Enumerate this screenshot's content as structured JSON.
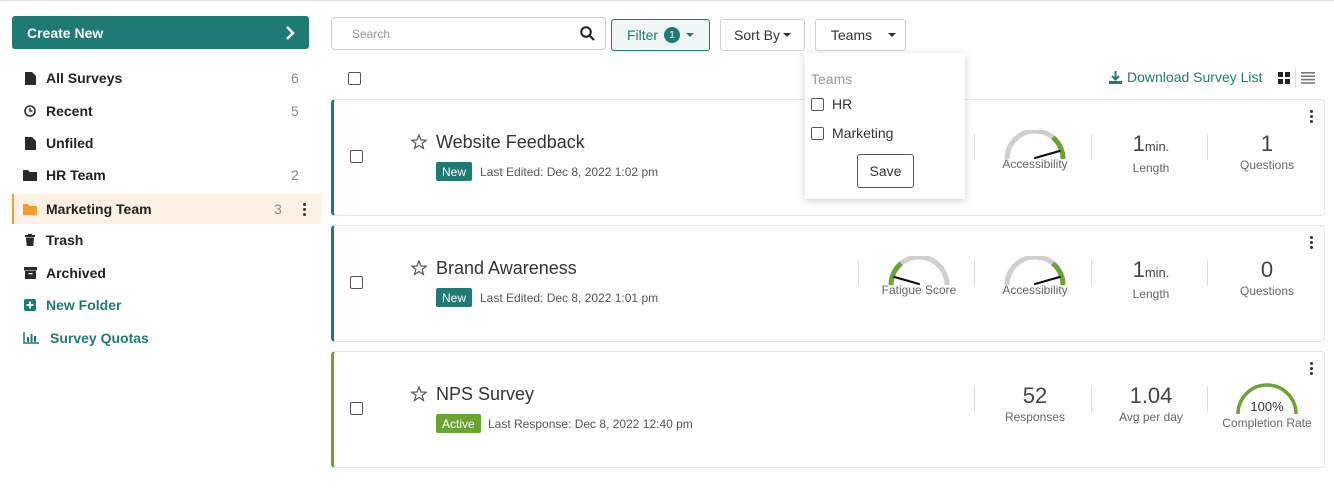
{
  "sidebar": {
    "create_label": "Create New",
    "items": [
      {
        "label": "All Surveys",
        "count": "6"
      },
      {
        "label": "Recent",
        "count": "5"
      },
      {
        "label": "Unfiled",
        "count": ""
      },
      {
        "label": "HR Team",
        "count": "2"
      },
      {
        "label": "Marketing Team",
        "count": "3"
      },
      {
        "label": "Trash",
        "count": ""
      },
      {
        "label": "Archived",
        "count": ""
      },
      {
        "label": "New Folder",
        "count": ""
      },
      {
        "label": "Survey Quotas",
        "count": ""
      }
    ]
  },
  "toolbar": {
    "search_placeholder": "Search",
    "filter_label": "Filter",
    "filter_count": "1",
    "sortby_label": "Sort By",
    "teams_label": "Teams"
  },
  "teams_dropdown": {
    "heading": "Teams",
    "options": [
      "HR",
      "Marketing"
    ],
    "save_label": "Save"
  },
  "list": {
    "download_label": "Download Survey List"
  },
  "surveys": [
    {
      "title": "Website Feedback",
      "status": "New",
      "meta": "Last Edited: Dec 8, 2022 1:02 pm",
      "gauge_accessibility_label": "Accessibility",
      "accessibility_level": 0.9,
      "length_value": "1",
      "length_unit": "min.",
      "length_label": "Length",
      "questions_value": "1",
      "questions_label": "Questions"
    },
    {
      "title": "Brand Awareness",
      "status": "New",
      "meta": "Last Edited: Dec 8, 2022 1:01 pm",
      "gauge_fatigue_label": "Fatigue Score",
      "fatigue_level": 0.1,
      "gauge_accessibility_label": "Accessibility",
      "accessibility_level": 0.9,
      "length_value": "1",
      "length_unit": "min.",
      "length_label": "Length",
      "questions_value": "0",
      "questions_label": "Questions"
    },
    {
      "title": "NPS Survey",
      "status": "Active",
      "meta": "Last Response: Dec 8, 2022 12:40 pm",
      "responses_value": "52",
      "responses_label": "Responses",
      "avg_value": "1.04",
      "avg_label": "Avg per day",
      "completion_value": "100%",
      "completion_label": "Completion Rate",
      "completion_level": 1.0
    }
  ],
  "colors": {
    "brand": "#1f7a74",
    "active_green": "#6aa534",
    "folder_orange": "#f39a3a"
  }
}
